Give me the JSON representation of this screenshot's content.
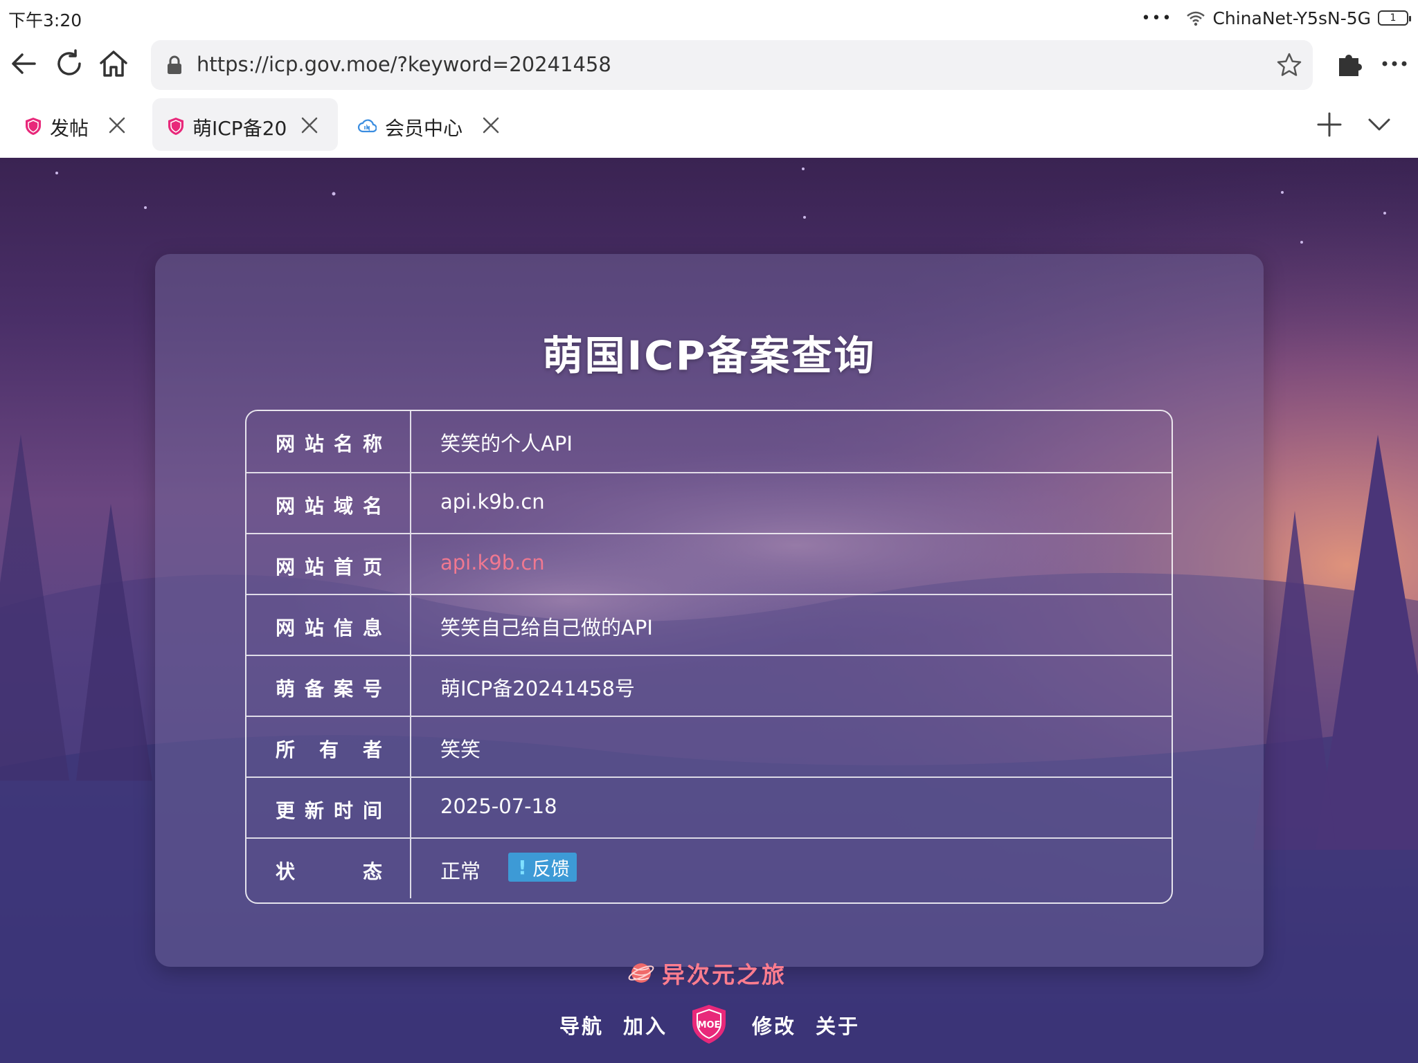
{
  "status_bar": {
    "time": "下午3:20",
    "dots": "•••",
    "wifi_name": "ChinaNet-Y5sN-5G",
    "battery_label": "1"
  },
  "address_bar": {
    "url": "https://icp.gov.moe/?keyword=20241458"
  },
  "tabs": [
    {
      "label": "发帖",
      "icon": "moe-shield-icon",
      "active": false
    },
    {
      "label": "萌ICP备20",
      "icon": "moe-shield-icon",
      "active": true
    },
    {
      "label": "会员中心",
      "icon": "cloud-icon",
      "active": false
    }
  ],
  "card": {
    "title": "萌国ICP备案查询",
    "rows": [
      {
        "label": [
          "网",
          "站",
          "名",
          "称"
        ],
        "value": "笑笑的个人API"
      },
      {
        "label": [
          "网",
          "站",
          "域",
          "名"
        ],
        "value": "api.k9b.cn"
      },
      {
        "label": [
          "网",
          "站",
          "首",
          "页"
        ],
        "value": "api.k9b.cn",
        "is_link": true
      },
      {
        "label": [
          "网",
          "站",
          "信",
          "息"
        ],
        "value": "笑笑自己给自己做的API"
      },
      {
        "label": [
          "萌",
          "备",
          "案",
          "号"
        ],
        "value": "萌ICP备20241458号"
      },
      {
        "label": [
          "所",
          "有",
          "者"
        ],
        "value": "笑笑"
      },
      {
        "label": [
          "更",
          "新",
          "时",
          "间"
        ],
        "value": "2025-07-18"
      },
      {
        "label": [
          "状",
          "态"
        ],
        "value": "正常",
        "badge": {
          "mark": "!",
          "text": "反馈"
        }
      }
    ]
  },
  "footer": {
    "brand": "异次元之旅",
    "nav": [
      "导航",
      "加入",
      "修改",
      "关于"
    ],
    "logo_text": "MOE"
  },
  "colors": {
    "link": "#f07890",
    "badge": "#3d9ad6",
    "brand_pink": "#ff7d8e",
    "moe_magenta": "#e8287a"
  }
}
